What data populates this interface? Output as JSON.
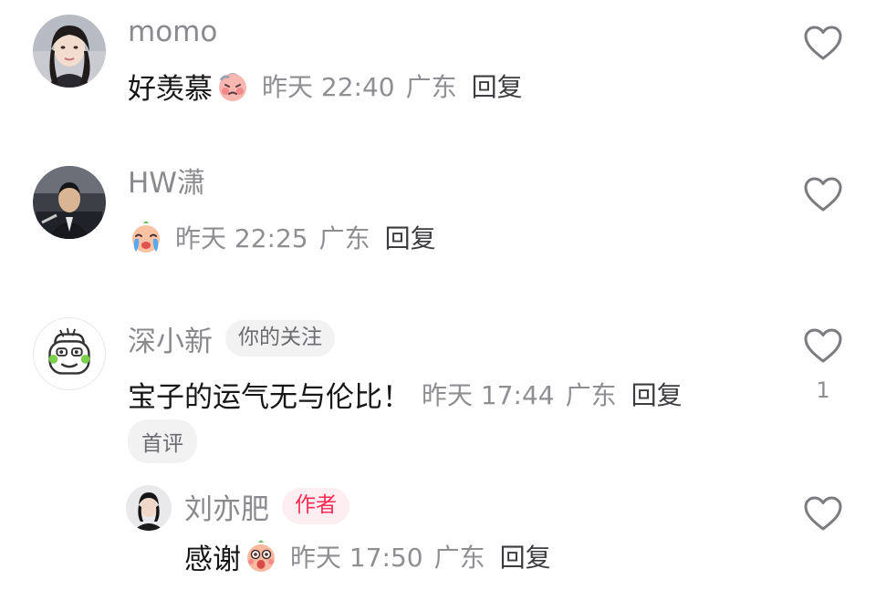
{
  "comments": [
    {
      "username": "momo",
      "content": "好羡慕",
      "emoji": "blushing-emoji",
      "date": "昨天",
      "time": "22:40",
      "location": "广东",
      "reply_label": "回复"
    },
    {
      "username": "HW潇",
      "content": "",
      "emoji": "crying-emoji",
      "date": "昨天",
      "time": "22:25",
      "location": "广东",
      "reply_label": "回复"
    },
    {
      "username": "深小新",
      "tag": "你的关注",
      "content": "宝子的运气无与伦比！",
      "date": "昨天",
      "time": "17:44",
      "location": "广东",
      "reply_label": "回复",
      "badge": "首评",
      "like_count": "1"
    }
  ],
  "reply": {
    "username": "刘亦肥",
    "tag": "作者",
    "content": "感谢",
    "emoji": "surprised-emoji",
    "date": "昨天",
    "time": "17:50",
    "location": "广东",
    "reply_label": "回复"
  },
  "colors": {
    "author_tag": "#fe2c55",
    "meta_text": "#8f8f93",
    "username": "#8a8a8e"
  },
  "icons": [
    "heart-outline-icon"
  ]
}
